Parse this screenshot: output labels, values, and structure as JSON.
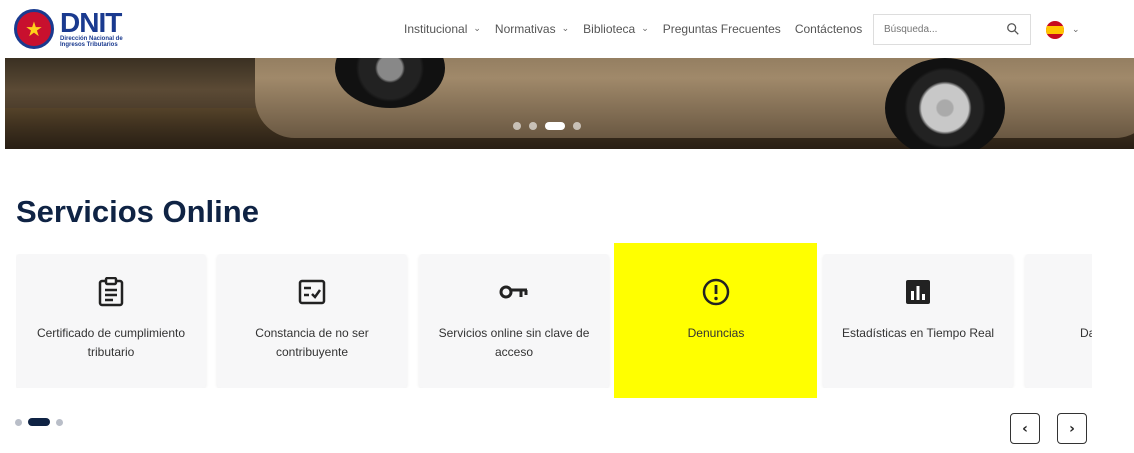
{
  "header": {
    "logo_text": "DNIT",
    "logo_subtitle_line1": "Dirección Nacional de",
    "logo_subtitle_line2": "Ingresos Tributarios",
    "nav": [
      {
        "label": "Institucional",
        "has_dropdown": true
      },
      {
        "label": "Normativas",
        "has_dropdown": true
      },
      {
        "label": "Biblioteca",
        "has_dropdown": true
      },
      {
        "label": "Preguntas Frecuentes",
        "has_dropdown": false
      },
      {
        "label": "Contáctenos",
        "has_dropdown": false
      }
    ],
    "search": {
      "placeholder": "Búsqueda...",
      "value": ""
    },
    "language": {
      "icon": "spain-flag-icon",
      "has_dropdown": true
    }
  },
  "hero": {
    "slides_count": 4,
    "active_slide": 3
  },
  "services": {
    "title": "Servicios Online",
    "cards": [
      {
        "label": "Certificado de cumplimiento tributario",
        "icon": "clipboard-list-icon"
      },
      {
        "label": "Constancia de no ser contribuyente",
        "icon": "checklist-icon"
      },
      {
        "label": "Servicios online sin clave de acceso",
        "icon": "key-icon"
      },
      {
        "label": "Denuncias",
        "icon": "alert-circle-icon",
        "highlighted": true
      },
      {
        "label": "Estadísticas en Tiempo Real",
        "icon": "bar-chart-icon"
      },
      {
        "label": "Da",
        "icon": ""
      }
    ],
    "pagination": {
      "pages": 3,
      "active_page": 2
    },
    "prev_label": "‹",
    "next_label": "›"
  },
  "colors": {
    "primary": "#0f2344",
    "highlight": "#ffff00",
    "card_bg": "#f7f7f8"
  }
}
